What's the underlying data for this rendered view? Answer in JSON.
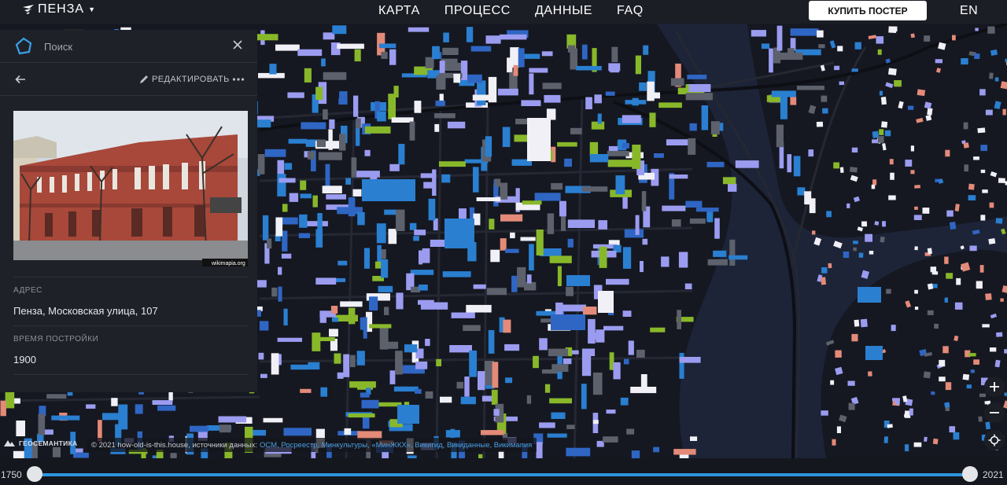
{
  "header": {
    "city": "ПЕНЗА",
    "nav": [
      "КАРТА",
      "ПРОЦЕСС",
      "ДАННЫЕ",
      "FAQ"
    ],
    "buy_poster": "КУПИТЬ ПОСТЕР",
    "lang": "EN"
  },
  "panel": {
    "search_placeholder": "Поиск",
    "edit_label": "РЕДАКТИРОВАТЬ",
    "photo_watermark": "wikimapia.org",
    "fields": [
      {
        "label": "АДРЕС",
        "value": "Пенза, Московская улица, 107"
      },
      {
        "label": "ВРЕМЯ ПОСТРОЙКИ",
        "value": "1900"
      }
    ]
  },
  "map": {
    "logo_text": "ГЕОСЕМАНТИКА",
    "attribution_prefix": "© 2021 how-old-is-this.house, источники данных:",
    "attribution_sources": "ОСМ, Росреестр, Минкультуры, «МинЖКХ», Викигид, Викиданные, Викимапия",
    "palette": [
      "#9b9cf0",
      "#2a7fd0",
      "#2f66c4",
      "#88b82a",
      "#f0f0f6",
      "#e48a78",
      "#5d616c"
    ],
    "icons": [
      "zoom-in-icon",
      "zoom-out-icon",
      "locate-icon"
    ]
  },
  "timeline": {
    "start_year": "1750",
    "end_year": "2021",
    "range_start": 0,
    "range_end": 1
  },
  "colors": {
    "accent": "#2e95dd",
    "panel_bg": "#1f2129",
    "topbar_bg": "#1c1e26"
  }
}
